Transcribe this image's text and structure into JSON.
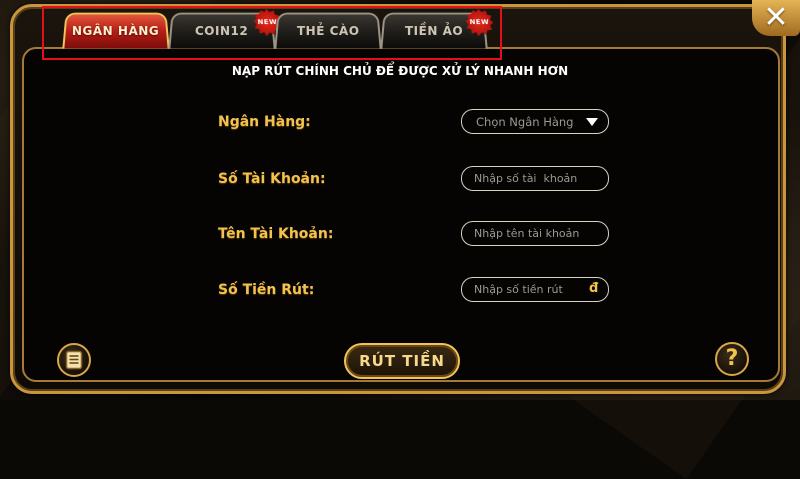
{
  "tabs": [
    {
      "label": "NGÂN HÀNG",
      "active": true,
      "new": false
    },
    {
      "label": "COIN12",
      "active": false,
      "new": true
    },
    {
      "label": "THẺ CÀO",
      "active": false,
      "new": false
    },
    {
      "label": "TIỀN ẢO",
      "active": false,
      "new": true
    }
  ],
  "badge_text": "NEW",
  "notice": "NẠP RÚT CHÍNH CHỦ ĐỂ ĐƯỢC XỬ LÝ NHANH HƠN",
  "form": {
    "bank_label": "Ngân Hàng:",
    "bank_select": "Chọn Ngân Hàng",
    "account_number_label": "Số Tài Khoản:",
    "account_number_placeholder": "Nhập số tài  khoản",
    "account_name_label": "Tên Tài Khoản:",
    "account_name_placeholder": "Nhập tên tài khoản",
    "amount_label": "Số Tiền Rút:",
    "amount_placeholder": "Nhập số tiền rút",
    "currency_symbol": "đ"
  },
  "withdraw_button": "RÚT TIỀN",
  "help_symbol": "?",
  "close_symbol": "✕",
  "colors": {
    "gold": "#f2c24e",
    "active_tab": "#b81e17",
    "highlight": "#e3101a"
  }
}
